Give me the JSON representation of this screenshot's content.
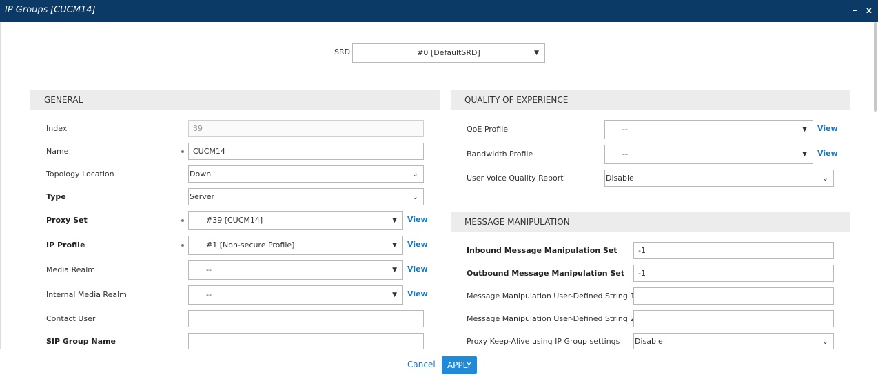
{
  "window": {
    "title": "IP Groups",
    "record": "[CUCM14]",
    "minimize_glyph": "–",
    "close_glyph": "x"
  },
  "srd": {
    "label": "SRD",
    "value": "#0 [DefaultSRD]"
  },
  "general": {
    "header": "GENERAL",
    "index": {
      "label": "Index",
      "value": "39"
    },
    "name": {
      "label": "Name",
      "value": "CUCM14"
    },
    "topology": {
      "label": "Topology Location",
      "value": "Down"
    },
    "type": {
      "label": "Type",
      "value": "Server"
    },
    "proxy_set": {
      "label": "Proxy Set",
      "value": "#39 [CUCM14]",
      "view": "View"
    },
    "ip_profile": {
      "label": "IP Profile",
      "value": "#1 [Non-secure Profile]",
      "view": "View"
    },
    "media_realm": {
      "label": "Media Realm",
      "value": "--",
      "view": "View"
    },
    "internal_media_realm": {
      "label": "Internal Media Realm",
      "value": "--",
      "view": "View"
    },
    "contact_user": {
      "label": "Contact User",
      "value": ""
    },
    "sip_group_name": {
      "label": "SIP Group Name",
      "value": ""
    }
  },
  "qoe": {
    "header": "QUALITY OF EXPERIENCE",
    "qoe_profile": {
      "label": "QoE Profile",
      "value": "--",
      "view": "View"
    },
    "bandwidth_profile": {
      "label": "Bandwidth Profile",
      "value": "--",
      "view": "View"
    },
    "user_voice_quality": {
      "label": "User Voice Quality Report",
      "value": "Disable"
    }
  },
  "msg": {
    "header": "MESSAGE MANIPULATION",
    "inbound": {
      "label": "Inbound Message Manipulation Set",
      "value": "-1"
    },
    "outbound": {
      "label": "Outbound Message Manipulation Set",
      "value": "-1"
    },
    "uds1": {
      "label": "Message Manipulation User-Defined String 1",
      "value": ""
    },
    "uds2": {
      "label": "Message Manipulation User-Defined String 2",
      "value": ""
    },
    "keepalive": {
      "label": "Proxy Keep-Alive using IP Group settings",
      "value": "Disable"
    }
  },
  "footer": {
    "cancel": "Cancel",
    "apply": "APPLY"
  },
  "icons": {
    "chevron": "chevron-down-icon",
    "triangle": "caret-down-icon",
    "required": "required-dot-icon"
  },
  "colors": {
    "titlebar": "#0b3a66",
    "accent": "#1f8bd8",
    "link": "#1b79c0",
    "section": "#ececec"
  }
}
